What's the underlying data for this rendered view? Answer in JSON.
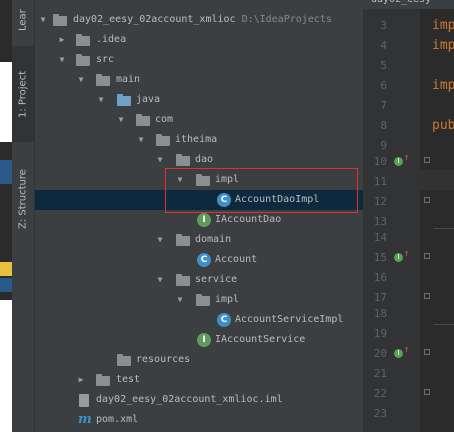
{
  "sidebar": {
    "learn_tab": "Lear",
    "project_tab": "1: Project",
    "structure_tab": "Z: Structure"
  },
  "tree": {
    "root": {
      "name": "day02_eesy_02account_xmlioc",
      "path": "D:\\IdeaProjects"
    },
    "items": [
      {
        "label": "day02_eesy_02account_xmlioc",
        "icon": "module-folder-icon"
      },
      {
        "label": ".idea",
        "icon": "folder-icon"
      },
      {
        "label": "src",
        "icon": "folder-icon"
      },
      {
        "label": "main",
        "icon": "folder-icon"
      },
      {
        "label": "java",
        "icon": "source-folder-icon"
      },
      {
        "label": "com",
        "icon": "package-icon"
      },
      {
        "label": "itheima",
        "icon": "package-icon"
      },
      {
        "label": "dao",
        "icon": "package-icon"
      },
      {
        "label": "impl",
        "icon": "package-icon"
      },
      {
        "label": "AccountDaoImpl",
        "icon": "class-icon"
      },
      {
        "label": "IAccountDao",
        "icon": "interface-icon"
      },
      {
        "label": "domain",
        "icon": "package-icon"
      },
      {
        "label": "Account",
        "icon": "class-icon"
      },
      {
        "label": "service",
        "icon": "package-icon"
      },
      {
        "label": "impl",
        "icon": "package-icon"
      },
      {
        "label": "AccountServiceImpl",
        "icon": "class-icon"
      },
      {
        "label": "IAccountService",
        "icon": "interface-icon"
      },
      {
        "label": "resources",
        "icon": "resources-folder-icon"
      },
      {
        "label": "test",
        "icon": "folder-icon"
      },
      {
        "label": "day02_eesy_02account_xmlioc.iml",
        "icon": "iml-file-icon"
      },
      {
        "label": "pom.xml",
        "icon": "maven-icon"
      }
    ],
    "selected_item": "AccountDaoImpl"
  },
  "editor": {
    "tab_title": "day02_eesy",
    "line_numbers": [
      "3",
      "4",
      "5",
      "6",
      "7",
      "8",
      "9",
      "10",
      "11",
      "12",
      "13",
      "14",
      "15",
      "16",
      "17",
      "18",
      "19",
      "20",
      "21",
      "22",
      "23"
    ],
    "code_fragments": {
      "line3": "imp",
      "line4": "imp",
      "line6": "imp",
      "line8": "pub"
    }
  },
  "colors": {
    "tree_bg": "#3c3f41",
    "selection": "#0d293e",
    "highlight_box": "#e03030",
    "keyword": "#cc7832",
    "class_icon": "#3f8fca",
    "interface_icon": "#5e9c5a"
  }
}
